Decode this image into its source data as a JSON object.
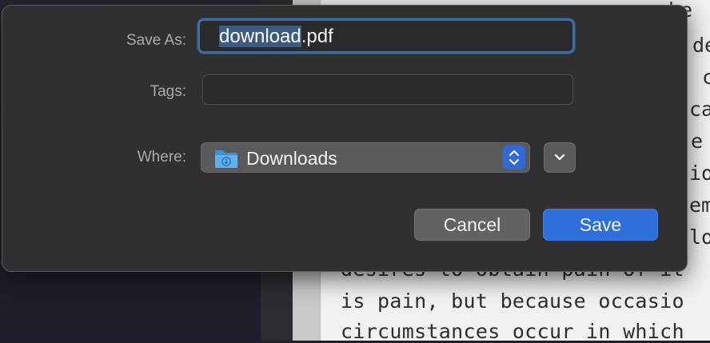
{
  "dialog": {
    "save_as_label": "Save As:",
    "filename_selected": "download",
    "filename_ext": ".pdf",
    "tags_label": "Tags:",
    "tags_value": "",
    "where_label": "Where:",
    "where_value": "Downloads",
    "where_icon": "downloads-folder-icon",
    "cancel_label": "Cancel",
    "save_label": "Save",
    "accent_color": "#2f6fd9"
  },
  "background_document": {
    "lines": [
      "desires to obtain pain of it",
      "is pain, but because occasio",
      "circumstances occur in which"
    ],
    "fragments": [
      "he",
      "de",
      "c",
      "ca",
      "e",
      "io",
      "em",
      "lo"
    ]
  }
}
